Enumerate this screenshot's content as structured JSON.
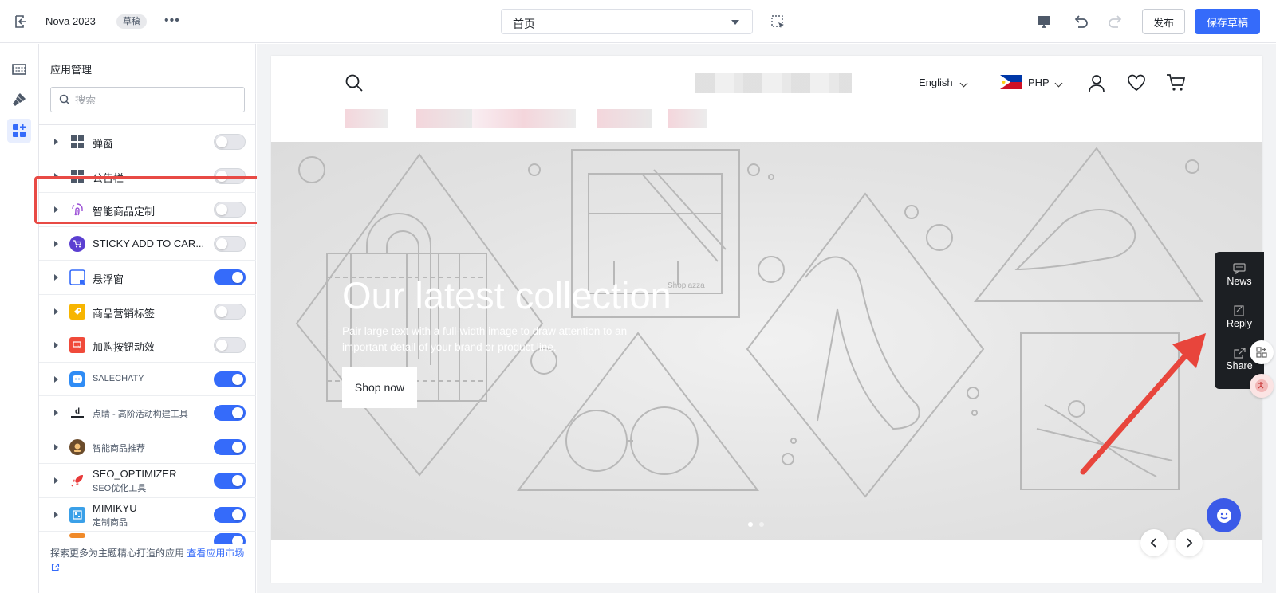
{
  "topbar": {
    "theme_name": "Nova 2023",
    "badge": "草稿",
    "more": "•••",
    "page_select": "首页",
    "publish_label": "发布",
    "save_label": "保存草稿"
  },
  "panel": {
    "title": "应用管理",
    "search_placeholder": "搜索",
    "apps": [
      {
        "name": "弹窗",
        "enabled": false
      },
      {
        "name": "公告栏",
        "enabled": false
      },
      {
        "name": "智能商品定制",
        "enabled": false
      },
      {
        "name": "STICKY ADD TO CAR...",
        "enabled": false
      },
      {
        "name": "悬浮窗",
        "enabled": true
      },
      {
        "name": "商品营销标签",
        "enabled": false
      },
      {
        "name": "加购按钮动效",
        "enabled": false
      },
      {
        "name": "SALECHATY",
        "enabled": true
      },
      {
        "name": "点睛 - 高阶活动构建工具",
        "enabled": true
      },
      {
        "name": "智能商品推荐",
        "enabled": true
      },
      {
        "name": "SEO_OPTIMIZER",
        "sub": "SEO优化工具",
        "enabled": true
      },
      {
        "name": "MIMIKYU",
        "sub": "定制商品",
        "enabled": true
      }
    ],
    "footer_text": "探索更多为主题精心打造的应用 ",
    "footer_link": "查看应用市场"
  },
  "store_header": {
    "language": "English",
    "currency": "PHP"
  },
  "hero": {
    "title": "Our latest collection",
    "subtitle": "Pair large text with a full-width image to draw attention to an important detail of your brand or product line.",
    "button": "Shop now",
    "watermark": "Shoplazza"
  },
  "float_panel": {
    "items": [
      "News",
      "Reply",
      "Share"
    ]
  },
  "colors": {
    "accent": "#356bfa",
    "highlight": "#e84a45",
    "float_bg": "#1c1f23",
    "chat": "#3b5ae8"
  }
}
